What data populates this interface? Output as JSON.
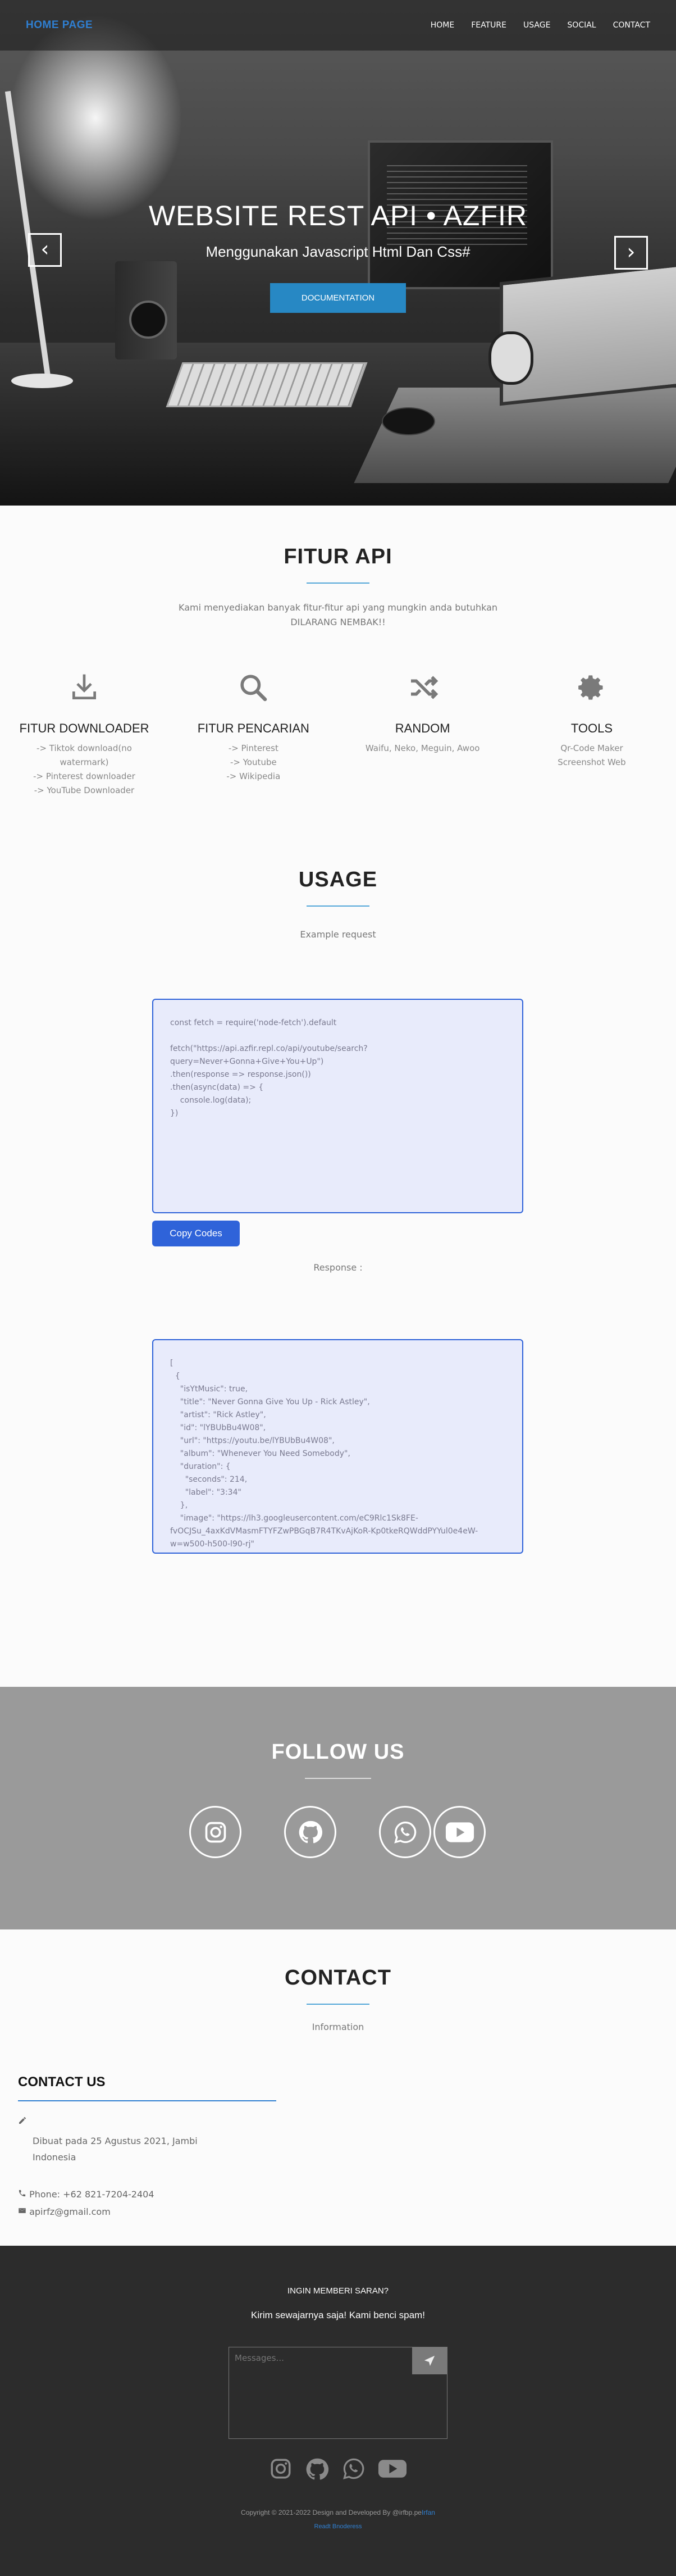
{
  "nav": {
    "brand": "HOME PAGE",
    "links": [
      "HOME",
      "FEATURE",
      "USAGE",
      "SOCIAL",
      "CONTACT"
    ]
  },
  "hero": {
    "title": "WEBSITE REST API • AZFIR",
    "subtitle": "Menggunakan Javascript Html Dan Css#",
    "button": "DOCUMENTATION",
    "prev_icon": "chevron-left-icon",
    "next_icon": "chevron-right-icon"
  },
  "fitur": {
    "title": "FITUR API",
    "desc": "Kami menyediakan banyak fitur-fitur api yang mungkin anda butuhkan DILARANG NEMBAK!!",
    "items": [
      {
        "icon": "download-icon",
        "title": "FITUR DOWNLOADER",
        "lines": [
          "-> Tiktok download(no watermark)",
          "-> Pinterest downloader",
          "-> YouTube Downloader"
        ]
      },
      {
        "icon": "search-icon",
        "title": "FITUR PENCARIAN",
        "lines": [
          "-> Pinterest",
          "-> Youtube",
          "-> Wikipedia"
        ]
      },
      {
        "icon": "shuffle-icon",
        "title": "RANDOM",
        "lines": [
          "Waifu, Neko, Meguin, Awoo"
        ]
      },
      {
        "icon": "gear-icon",
        "title": "TOOLS",
        "lines": [
          "Qr-Code Maker",
          "Screenshot Web"
        ]
      }
    ]
  },
  "usage": {
    "title": "USAGE",
    "desc": "Example request",
    "request_code": "const fetch = require('node-fetch').default\n\nfetch(\"https://api.azfir.repl.co/api/youtube/search?\nquery=Never+Gonna+Give+You+Up\")\n.then(response => response.json())\n.then(async(data) => {\n    console.log(data);\n})",
    "copy_button": "Copy Codes",
    "response_label": "Response :",
    "response_code": "[\n  {\n    \"isYtMusic\": true,\n    \"title\": \"Never Gonna Give You Up - Rick Astley\",\n    \"artist\": \"Rick Astley\",\n    \"id\": \"lYBUbBu4W08\",\n    \"url\": \"https://youtu.be/lYBUbBu4W08\",\n    \"album\": \"Whenever You Need Somebody\",\n    \"duration\": {\n      \"seconds\": 214,\n      \"label\": \"3:34\"\n    },\n    \"image\": \"https://lh3.googleusercontent.com/eC9Rlc1Sk8FE-\nfvOCJSu_4axKdVMasmFTYFZwPBGqB7R4TKvAjKoR-Kp0tkeRQWddPYYul0e4eW-\nw=w500-h500-l90-rj\""
  },
  "follow": {
    "title": "FOLLOW US",
    "icons": [
      "instagram-icon",
      "github-icon",
      "whatsapp-icon",
      "youtube-icon"
    ]
  },
  "contact": {
    "title": "CONTACT",
    "desc": "Information",
    "heading": "CONTACT US",
    "made_line1": "Dibuat pada 25 Agustus 2021, Jambi",
    "made_line2": "Indonesia",
    "phone": "Phone: +62 821-7204-2404",
    "email": "apirfz@gmail.com"
  },
  "footer": {
    "question": "INGIN MEMBERI SARAN?",
    "prompt": "Kirim sewajarnya saja! Kami benci spam!",
    "placeholder": "Messages...",
    "copyright_prefix": "Copyright © 2021-2022 Design and Developed By @irfbp.pe",
    "copyright_link": "Irfan",
    "readme": "Readt Bnoderess"
  },
  "colors": {
    "brand": "#2f7fd1",
    "accent": "#2f63d9",
    "doc_button": "#2788c4",
    "footer_bg": "#2c2c2c",
    "follow_bg": "#9a9a9a"
  }
}
